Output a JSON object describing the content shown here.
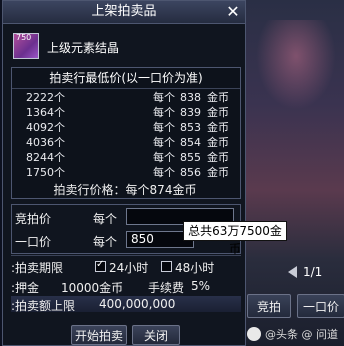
{
  "dialog": {
    "title": "上架拍卖品",
    "close_glyph": "✕",
    "item": {
      "level": "750",
      "name": "上级元素结晶"
    },
    "price_list": {
      "header": "拍卖行最低价(以一口价为准)",
      "rows": [
        {
          "qty": "2222个",
          "per": "每个",
          "price": "838",
          "unit": "金币"
        },
        {
          "qty": "1364个",
          "per": "每个",
          "price": "839",
          "unit": "金币"
        },
        {
          "qty": "4092个",
          "per": "每个",
          "price": "853",
          "unit": "金币"
        },
        {
          "qty": "4036个",
          "per": "每个",
          "price": "854",
          "unit": "金币"
        },
        {
          "qty": "8244个",
          "per": "每个",
          "price": "855",
          "unit": "金币"
        },
        {
          "qty": "1750个",
          "per": "每个",
          "price": "856",
          "unit": "金币"
        }
      ]
    },
    "suggested_price": "拍卖行价格：每个874金币",
    "form": {
      "bid_label": "竞拍价",
      "bid_per": "每个",
      "bid_value": "",
      "buyout_label": "一口价",
      "buyout_per": "每个",
      "buyout_value": "850",
      "tooltip": "总共63万7500金币",
      "duration_label": ":拍卖期限",
      "opt_24h": "24小时",
      "opt_48h": "48小时",
      "deposit_label": ":押金",
      "deposit_value": "10000金币",
      "fee_label": "手续费",
      "fee_value": "5%",
      "limit_label": ":拍卖额上限",
      "limit_value": "400,000,000"
    },
    "buttons": {
      "start": "开始拍卖",
      "close": "关闭"
    }
  },
  "side": {
    "page": "1/1",
    "bid_button": "竞拍",
    "buyout_button": "一口价",
    "watermark": "@头条 @ 问道"
  }
}
